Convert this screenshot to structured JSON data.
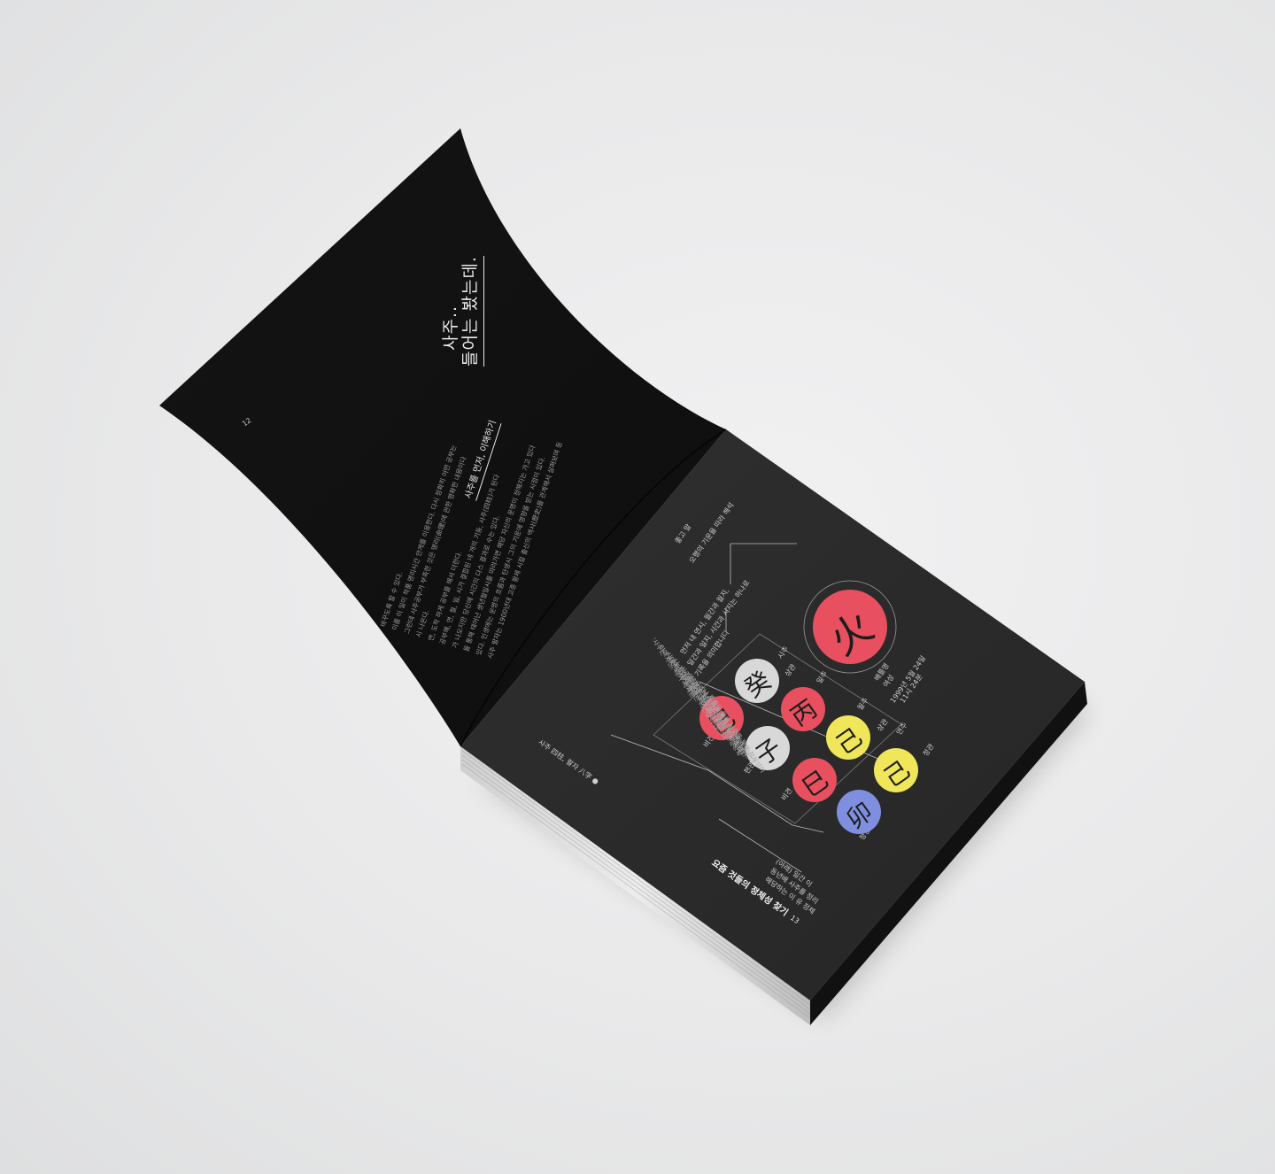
{
  "left_page": {
    "title_line1": "사주..",
    "title_line2": "들어는 봤는데.",
    "page_number": "12",
    "section_heading": "사주를 먼저, 이해하기",
    "body_lines": [
      "사주 팔자는 1900년대 고종 황제 시절 출신의 역사(歷史)를 관계해서 살펴보며 등",
      "있다. 인생에는 운명의 흐름과 탄생시 그의 기운에 영향을 받는 시점이 있다.",
      "을 통해 태어난 생년월일시를 따라가면 해당 자신의 운명이 정해지는 가고 있다",
      "가 나오지만 당신에 시간의 다스 결과로 수는 있다.",
      "공부해, 연, 월, 일, 시가 결합된 네 개의 기둥, 사주(四柱)가 된다",
      "연, 도착 하게 공부를 해서 더한다.",
      "시 나온다.",
      "그런데 사주공부가 부족한 것은 명리(命理)에 관한 명확한 내용이다",
      "이를 이 일이 작품 명리시간 안게를 이용한다. 다시 정확히 어떤 공부는",
      "바꾸도록 할 수 있다."
    ]
  },
  "right_page": {
    "top_label_1": "좋고 말",
    "top_label_2": "오행의 기운을 따라 해석",
    "side_note_1": "먼저 내 연시, 월간과 월지,",
    "side_note_2": "일간과 일지, 시간과 시지는 하나로",
    "side_note_3": "기록을 의미합니다",
    "big_glyph": "火",
    "info_1": "배틀명",
    "info_2": "여성",
    "info_3": "1999년 5월 24일",
    "info_4": "11시 24분",
    "col_labels": [
      "시주",
      "일주",
      "월주",
      "연주"
    ],
    "row_label_top": "천간",
    "row_label_bottom": "지지",
    "tag_labels": [
      "상관",
      "상관",
      "비견",
      "편관",
      "정관",
      "비견",
      "정인"
    ],
    "body_lines": [
      "'사주는 자신, 내가 세계는",
      "이에 자신을 대상 관련한 의견들이 많으며",
      "시대에 따라 말하는 세계가 있었다",
      "나 자신을 찾아 만든 보다 자신의 진행방향",
      "사주를 통해 진짜 내 주변의 힘을 통해",
      "생활방식의 방향이 있기 때문에 관련",
      "사주에서 관련 정리하고 정리 자신이",
      "'나 통해 세계를 알 수가 있다'",
      "흐름을 통해 사주를 통해 정체성이"
    ],
    "footer_left": "사주 四柱, 팔자 八字 ●",
    "footer_title": "요즘 것들의 정체성 찾기",
    "footer_note_1": "(아래) 일간 이",
    "footer_note_2": "동년배 사주를 정리",
    "footer_note_3": "해당하는 이 유 정체",
    "page_number": "13"
  },
  "circles": [
    {
      "glyph": "癸",
      "color": "#d8d8d8"
    },
    {
      "glyph": "丙",
      "color": "#e8505f"
    },
    {
      "glyph": "己",
      "color": "#f0e65a"
    },
    {
      "glyph": "己",
      "color": "#f0e65a"
    },
    {
      "glyph": "巳",
      "color": "#e8505f"
    },
    {
      "glyph": "子",
      "color": "#d8d8d8"
    },
    {
      "glyph": "巳",
      "color": "#e8505f"
    },
    {
      "glyph": "卯",
      "color": "#7f8fe0"
    }
  ],
  "colors": {
    "background": "#e9e9ea",
    "page_dark": "#1a1a1a",
    "page_right": "#2b2b2b",
    "red": "#e8505f",
    "yellow": "#f0e65a",
    "blue": "#7f8fe0",
    "grey": "#d8d8d8"
  }
}
